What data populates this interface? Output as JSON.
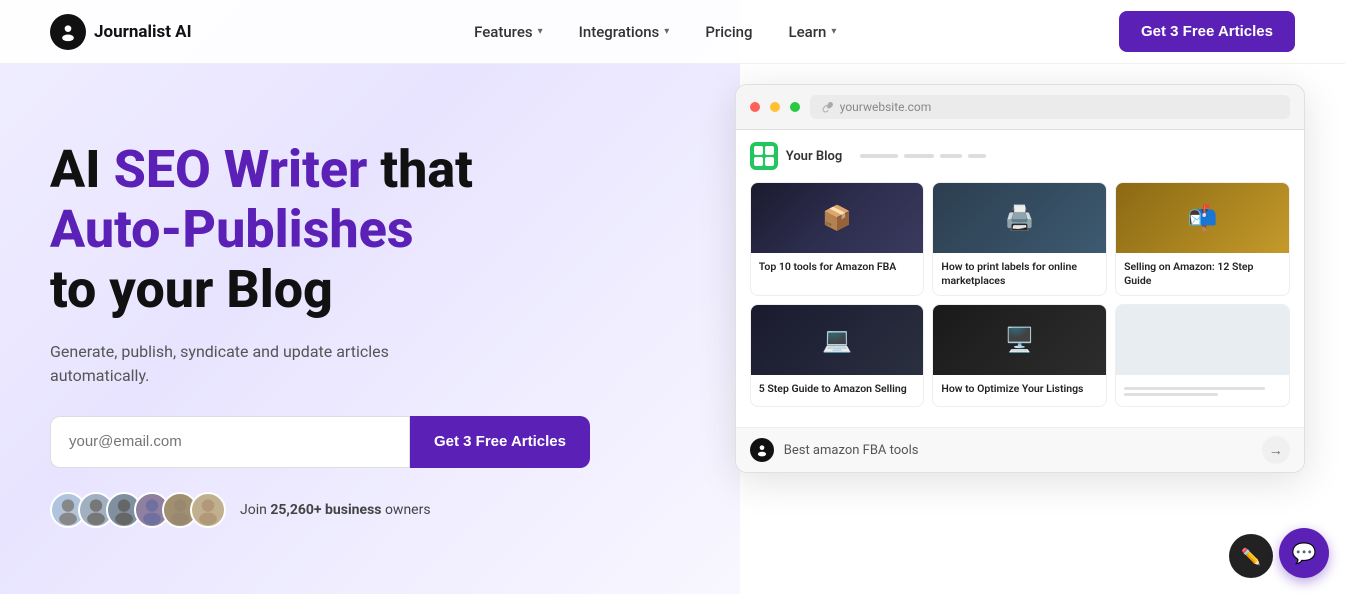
{
  "brand": {
    "name": "Journalist AI",
    "logo_symbol": "🎭"
  },
  "navbar": {
    "features_label": "Features",
    "integrations_label": "Integrations",
    "pricing_label": "Pricing",
    "learn_label": "Learn",
    "cta_label": "Get 3 Free Articles"
  },
  "hero": {
    "headline_part1": "AI ",
    "headline_purple": "SEO Writer",
    "headline_part2": " that",
    "headline_line2": "Auto-Publishes",
    "headline_line3": "to your Blog",
    "subheadline": "Generate, publish, syndicate and update articles automatically.",
    "email_placeholder": "your@email.com",
    "email_cta": "Get 3 Free Articles",
    "social_text_normal": "Join ",
    "social_count": "25,260+",
    "social_text_bold": " business",
    "social_text_end": " owners"
  },
  "browser": {
    "url": "yourwebsite.com",
    "blog_title": "Your Blog",
    "articles": [
      {
        "id": 1,
        "title": "Top 10 tools for Amazon FBA",
        "img_class": "article-img-1"
      },
      {
        "id": 2,
        "title": "How to print labels for online marketplaces",
        "img_class": "article-img-2"
      },
      {
        "id": 3,
        "title": "Selling on Amazon: 12 Step Guide",
        "img_class": "article-img-3"
      },
      {
        "id": 4,
        "title": "5 Step Guide to Amazon Selling",
        "img_class": "article-img-4"
      },
      {
        "id": 5,
        "title": "How to Optimize Your Listings",
        "img_class": "article-img-5"
      },
      {
        "id": 6,
        "title": "",
        "img_class": "article-img-6"
      }
    ],
    "bot_query": "Best amazon FBA tools"
  },
  "colors": {
    "purple": "#5b21b6",
    "dark": "#111111",
    "text": "#333333"
  }
}
